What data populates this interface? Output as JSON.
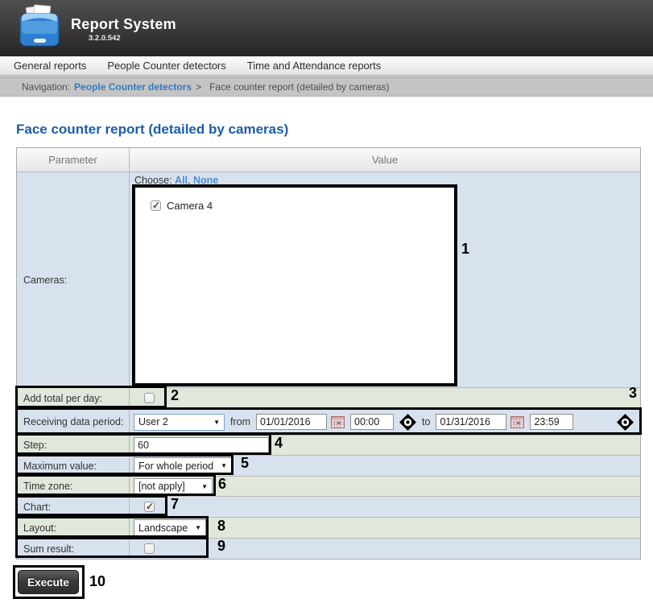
{
  "header": {
    "title": "Report System",
    "version": "3.2.0.542"
  },
  "menu": {
    "items": [
      "General reports",
      "People Counter detectors",
      "Time and Attendance reports"
    ]
  },
  "breadcrumb": {
    "prefix": "Navigation:",
    "link": "People Counter detectors",
    "separator": ">",
    "current": "Face counter report (detailed by cameras)"
  },
  "page": {
    "title": "Face counter report (detailed by cameras)"
  },
  "table": {
    "headers": {
      "parameter": "Parameter",
      "value": "Value"
    },
    "cameras": {
      "label": "Cameras:",
      "choose_label": "Choose:",
      "all_link": "All",
      "comma": ",",
      "none_link": "None",
      "items": [
        {
          "label": "Camera 4",
          "checked": true
        }
      ]
    },
    "add_total": {
      "label": "Add total per day:",
      "checked": false
    },
    "receiving": {
      "label": "Receiving data period:",
      "period_select": "User 2",
      "from_label": "from",
      "from_date": "01/01/2016",
      "from_time": "00:00",
      "to_label": "to",
      "to_date": "01/31/2016",
      "to_time": "23:59"
    },
    "step": {
      "label": "Step:",
      "value": "60"
    },
    "maximum": {
      "label": "Maximum value:",
      "value": "For whole period"
    },
    "timezone": {
      "label": "Time zone:",
      "value": "[not apply]"
    },
    "chart": {
      "label": "Chart:",
      "checked": true
    },
    "layout": {
      "label": "Layout:",
      "value": "Landscape"
    },
    "sum": {
      "label": "Sum result:",
      "checked": false
    }
  },
  "execute": {
    "label": "Execute"
  },
  "annotations": {
    "labels": [
      "1",
      "2",
      "3",
      "4",
      "5",
      "6",
      "7",
      "8",
      "9",
      "10"
    ]
  },
  "colors": {
    "accent_blue_link": "#4a8fd4",
    "title_blue": "#1d5ca8",
    "row_blue": "#d8e2ef",
    "row_green": "#dfe8da",
    "header_dark": "#3a3938"
  }
}
